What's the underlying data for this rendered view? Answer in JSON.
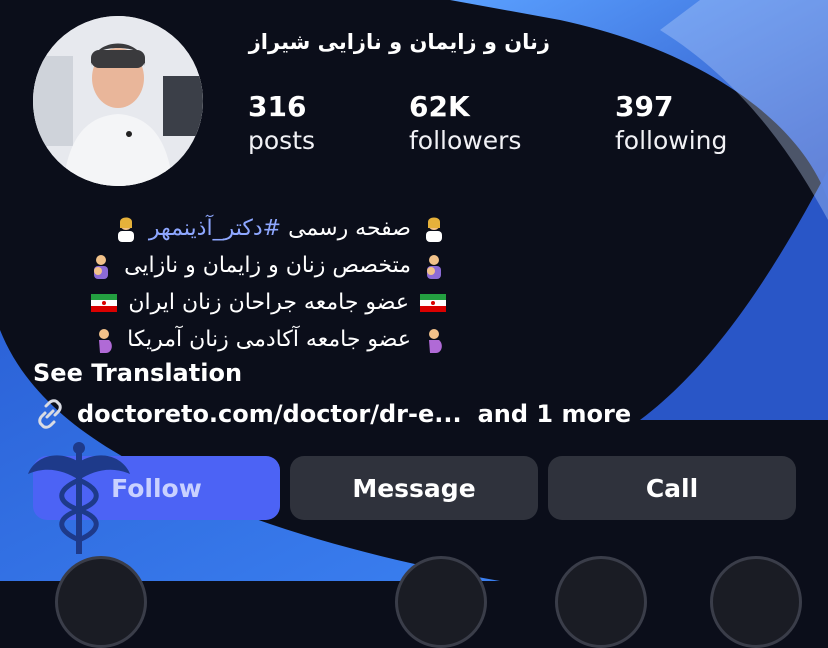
{
  "profile": {
    "name": "زنان و زایمان و نازایی شیراز",
    "avatar_alt": "doctor portrait"
  },
  "stats": [
    {
      "value": "316",
      "label": "posts"
    },
    {
      "value": "62K",
      "label": "followers"
    },
    {
      "value": "397",
      "label": "following"
    }
  ],
  "bio": {
    "line1_text": "صفحه رسمی",
    "line1_hashtag": "#دکتر_آذینمهر",
    "line2": "متخصص زنان و زایمان و نازایی",
    "line3": "عضو جامعه جراحان زنان ایران",
    "line4": "عضو جامعه آکادمی زنان آمریکا"
  },
  "see_translation": "See Translation",
  "link": {
    "url": "doctoreto.com/doctor/dr-e...",
    "more": "and 1 more"
  },
  "buttons": {
    "follow": "Follow",
    "message": "Message",
    "call": "Call"
  },
  "colors": {
    "background": "#0b0e1a",
    "accent_blue": "#4c63f5",
    "hashtag": "#8ea7ff",
    "button_dark": "#2f323c",
    "wave_blue": "#3f6fd9"
  }
}
